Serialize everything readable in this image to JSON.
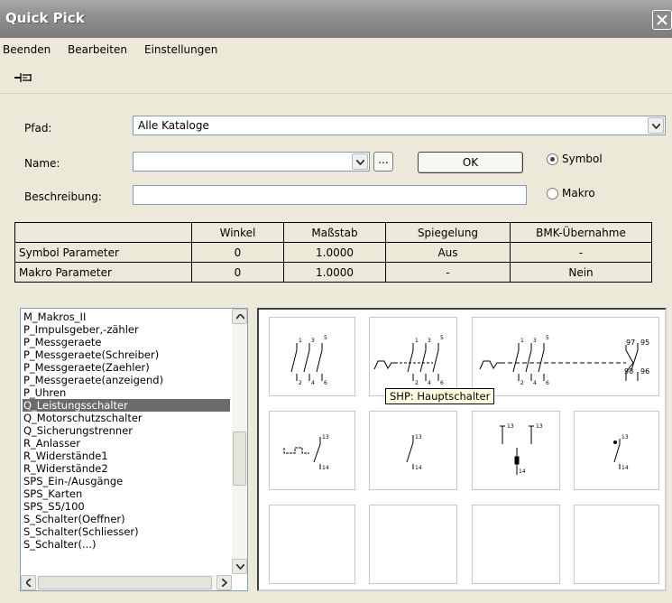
{
  "window": {
    "title": "Quick Pick"
  },
  "menu": [
    "Beenden",
    "Bearbeiten",
    "Einstellungen"
  ],
  "form": {
    "path_label": "Pfad:",
    "path_value": "Alle Kataloge",
    "name_label": "Name:",
    "name_value": "",
    "ellipsis_label": "...",
    "ok_label": "OK",
    "desc_label": "Beschreibung:",
    "desc_value": "",
    "radio_symbol": "Symbol",
    "radio_macro": "Makro",
    "selected_radio": "Symbol"
  },
  "params_table": {
    "headers": [
      "",
      "Winkel",
      "Maßstab",
      "Spiegelung",
      "BMK-Übernahme"
    ],
    "rows": [
      [
        "Symbol Parameter",
        "0",
        "1.0000",
        "Aus",
        "-"
      ],
      [
        "Makro Parameter",
        "0",
        "1.0000",
        "-",
        "Nein"
      ]
    ]
  },
  "catalog_list": {
    "items": [
      "M_Makros_II",
      "P_Impulsgeber,-zähler",
      "P_Messgeraete",
      "P_Messgeraete(Schreiber)",
      "P_Messgeraete(Zaehler)",
      "P_Messgeraete(anzeigend)",
      "P_Uhren",
      "Q_Leistungsschalter",
      "Q_Motorschutzschalter",
      "Q_Sicherungstrenner",
      "R_Anlasser",
      "R_Widerstände1",
      "R_Widerstände2",
      "SPS_Ein-/Ausgänge",
      "SPS_Karten",
      "SPS_S5/100",
      "S_Schalter(Oeffner)",
      "S_Schalter(Schliesser)",
      "S_Schalter(...)"
    ],
    "selected_index": 7
  },
  "symbols": {
    "tooltip": "SHP: Hauptschalter",
    "labels": {
      "s1": [
        "1",
        "3",
        "5",
        "2",
        "4",
        "6"
      ],
      "s3": [
        "1",
        "3",
        "5",
        "2",
        "4",
        "6",
        "97",
        "95",
        "98",
        "96"
      ],
      "s4": [
        "13",
        "14"
      ],
      "s5": [
        "13",
        "14"
      ],
      "s6": [
        "13",
        "14",
        "13",
        "14"
      ],
      "s7": [
        "13",
        "14"
      ]
    }
  }
}
